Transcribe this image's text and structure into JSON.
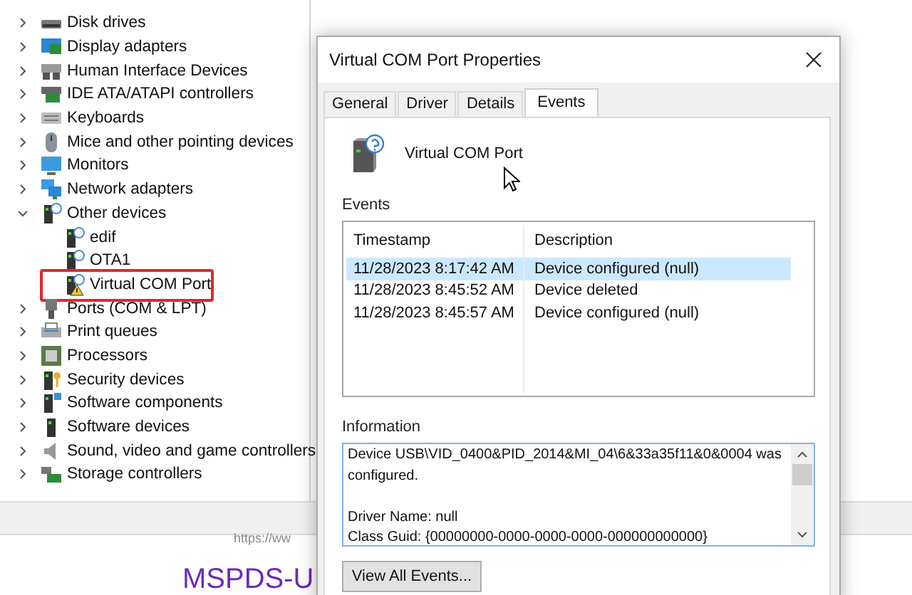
{
  "device_tree": [
    {
      "label": "Disk drives",
      "expanded": false
    },
    {
      "label": "Display adapters",
      "expanded": false
    },
    {
      "label": "Human Interface Devices",
      "expanded": false
    },
    {
      "label": "IDE ATA/ATAPI controllers",
      "expanded": false
    },
    {
      "label": "Keyboards",
      "expanded": false
    },
    {
      "label": "Mice and other pointing devices",
      "expanded": false
    },
    {
      "label": "Monitors",
      "expanded": false
    },
    {
      "label": "Network adapters",
      "expanded": false
    },
    {
      "label": "Other devices",
      "expanded": true,
      "children": [
        {
          "label": "edif",
          "warning": false,
          "highlighted": false
        },
        {
          "label": "OTA1",
          "warning": false,
          "highlighted": false
        },
        {
          "label": "Virtual COM Port",
          "warning": true,
          "highlighted": true
        }
      ]
    },
    {
      "label": "Ports (COM & LPT)",
      "expanded": false
    },
    {
      "label": "Print queues",
      "expanded": false
    },
    {
      "label": "Processors",
      "expanded": false
    },
    {
      "label": "Security devices",
      "expanded": false
    },
    {
      "label": "Software components",
      "expanded": false
    },
    {
      "label": "Software devices",
      "expanded": false
    },
    {
      "label": "Sound, video and game controllers",
      "expanded": false
    },
    {
      "label": "Storage controllers",
      "expanded": false
    }
  ],
  "background_page": {
    "url": "https://ww",
    "heading": "MSPDS-U"
  },
  "dialog": {
    "title": "Virtual COM Port Properties",
    "tabs": [
      {
        "label": "General",
        "selected": false
      },
      {
        "label": "Driver",
        "selected": false
      },
      {
        "label": "Details",
        "selected": false
      },
      {
        "label": "Events",
        "selected": true
      }
    ],
    "device_name": "Virtual COM Port",
    "events_label": "Events",
    "events_table": {
      "columns": [
        "Timestamp",
        "Description"
      ],
      "rows": [
        {
          "cells": [
            "11/28/2023 8:17:42 AM",
            "Device configured (null)"
          ],
          "selected": true
        },
        {
          "cells": [
            "11/28/2023 8:45:52 AM",
            "Device deleted"
          ],
          "selected": false
        },
        {
          "cells": [
            "11/28/2023 8:45:57 AM",
            "Device configured (null)"
          ],
          "selected": false
        }
      ]
    },
    "information_label": "Information",
    "information_text": "Device USB\\VID_0400&PID_2014&MI_04\\6&33a35f11&0&0004 was configured.\n\nDriver Name: null\nClass Guid: {00000000-0000-0000-0000-000000000000}",
    "button": "View All Events..."
  }
}
